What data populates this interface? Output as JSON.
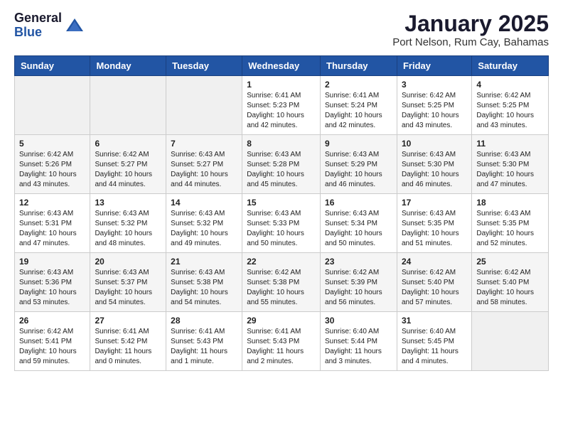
{
  "header": {
    "logo_general": "General",
    "logo_blue": "Blue",
    "title": "January 2025",
    "subtitle": "Port Nelson, Rum Cay, Bahamas"
  },
  "weekdays": [
    "Sunday",
    "Monday",
    "Tuesday",
    "Wednesday",
    "Thursday",
    "Friday",
    "Saturday"
  ],
  "weeks": [
    [
      {
        "day": "",
        "info": ""
      },
      {
        "day": "",
        "info": ""
      },
      {
        "day": "",
        "info": ""
      },
      {
        "day": "1",
        "info": "Sunrise: 6:41 AM\nSunset: 5:23 PM\nDaylight: 10 hours\nand 42 minutes."
      },
      {
        "day": "2",
        "info": "Sunrise: 6:41 AM\nSunset: 5:24 PM\nDaylight: 10 hours\nand 42 minutes."
      },
      {
        "day": "3",
        "info": "Sunrise: 6:42 AM\nSunset: 5:25 PM\nDaylight: 10 hours\nand 43 minutes."
      },
      {
        "day": "4",
        "info": "Sunrise: 6:42 AM\nSunset: 5:25 PM\nDaylight: 10 hours\nand 43 minutes."
      }
    ],
    [
      {
        "day": "5",
        "info": "Sunrise: 6:42 AM\nSunset: 5:26 PM\nDaylight: 10 hours\nand 43 minutes."
      },
      {
        "day": "6",
        "info": "Sunrise: 6:42 AM\nSunset: 5:27 PM\nDaylight: 10 hours\nand 44 minutes."
      },
      {
        "day": "7",
        "info": "Sunrise: 6:43 AM\nSunset: 5:27 PM\nDaylight: 10 hours\nand 44 minutes."
      },
      {
        "day": "8",
        "info": "Sunrise: 6:43 AM\nSunset: 5:28 PM\nDaylight: 10 hours\nand 45 minutes."
      },
      {
        "day": "9",
        "info": "Sunrise: 6:43 AM\nSunset: 5:29 PM\nDaylight: 10 hours\nand 46 minutes."
      },
      {
        "day": "10",
        "info": "Sunrise: 6:43 AM\nSunset: 5:30 PM\nDaylight: 10 hours\nand 46 minutes."
      },
      {
        "day": "11",
        "info": "Sunrise: 6:43 AM\nSunset: 5:30 PM\nDaylight: 10 hours\nand 47 minutes."
      }
    ],
    [
      {
        "day": "12",
        "info": "Sunrise: 6:43 AM\nSunset: 5:31 PM\nDaylight: 10 hours\nand 47 minutes."
      },
      {
        "day": "13",
        "info": "Sunrise: 6:43 AM\nSunset: 5:32 PM\nDaylight: 10 hours\nand 48 minutes."
      },
      {
        "day": "14",
        "info": "Sunrise: 6:43 AM\nSunset: 5:32 PM\nDaylight: 10 hours\nand 49 minutes."
      },
      {
        "day": "15",
        "info": "Sunrise: 6:43 AM\nSunset: 5:33 PM\nDaylight: 10 hours\nand 50 minutes."
      },
      {
        "day": "16",
        "info": "Sunrise: 6:43 AM\nSunset: 5:34 PM\nDaylight: 10 hours\nand 50 minutes."
      },
      {
        "day": "17",
        "info": "Sunrise: 6:43 AM\nSunset: 5:35 PM\nDaylight: 10 hours\nand 51 minutes."
      },
      {
        "day": "18",
        "info": "Sunrise: 6:43 AM\nSunset: 5:35 PM\nDaylight: 10 hours\nand 52 minutes."
      }
    ],
    [
      {
        "day": "19",
        "info": "Sunrise: 6:43 AM\nSunset: 5:36 PM\nDaylight: 10 hours\nand 53 minutes."
      },
      {
        "day": "20",
        "info": "Sunrise: 6:43 AM\nSunset: 5:37 PM\nDaylight: 10 hours\nand 54 minutes."
      },
      {
        "day": "21",
        "info": "Sunrise: 6:43 AM\nSunset: 5:38 PM\nDaylight: 10 hours\nand 54 minutes."
      },
      {
        "day": "22",
        "info": "Sunrise: 6:42 AM\nSunset: 5:38 PM\nDaylight: 10 hours\nand 55 minutes."
      },
      {
        "day": "23",
        "info": "Sunrise: 6:42 AM\nSunset: 5:39 PM\nDaylight: 10 hours\nand 56 minutes."
      },
      {
        "day": "24",
        "info": "Sunrise: 6:42 AM\nSunset: 5:40 PM\nDaylight: 10 hours\nand 57 minutes."
      },
      {
        "day": "25",
        "info": "Sunrise: 6:42 AM\nSunset: 5:40 PM\nDaylight: 10 hours\nand 58 minutes."
      }
    ],
    [
      {
        "day": "26",
        "info": "Sunrise: 6:42 AM\nSunset: 5:41 PM\nDaylight: 10 hours\nand 59 minutes."
      },
      {
        "day": "27",
        "info": "Sunrise: 6:41 AM\nSunset: 5:42 PM\nDaylight: 11 hours\nand 0 minutes."
      },
      {
        "day": "28",
        "info": "Sunrise: 6:41 AM\nSunset: 5:43 PM\nDaylight: 11 hours\nand 1 minute."
      },
      {
        "day": "29",
        "info": "Sunrise: 6:41 AM\nSunset: 5:43 PM\nDaylight: 11 hours\nand 2 minutes."
      },
      {
        "day": "30",
        "info": "Sunrise: 6:40 AM\nSunset: 5:44 PM\nDaylight: 11 hours\nand 3 minutes."
      },
      {
        "day": "31",
        "info": "Sunrise: 6:40 AM\nSunset: 5:45 PM\nDaylight: 11 hours\nand 4 minutes."
      },
      {
        "day": "",
        "info": ""
      }
    ]
  ]
}
